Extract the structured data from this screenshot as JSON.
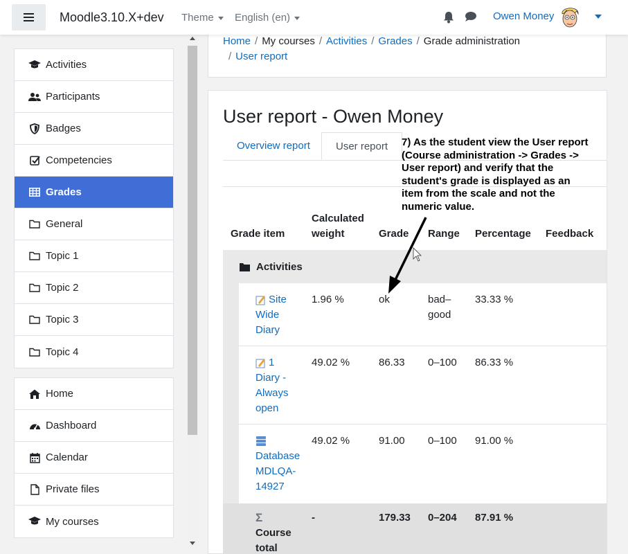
{
  "navbar": {
    "brand": "Moodle3.10.X+dev",
    "theme_label": "Theme",
    "language_label": "English (en)",
    "user_name": "Owen Money"
  },
  "drawer": {
    "course_items": [
      {
        "label": "Activities",
        "icon": "graduation-cap-icon"
      },
      {
        "label": "Participants",
        "icon": "users-icon"
      },
      {
        "label": "Badges",
        "icon": "shield-icon"
      },
      {
        "label": "Competencies",
        "icon": "check-square-icon"
      },
      {
        "label": "Grades",
        "icon": "table-icon",
        "active": true
      },
      {
        "label": "General",
        "icon": "folder-icon"
      },
      {
        "label": "Topic 1",
        "icon": "folder-icon"
      },
      {
        "label": "Topic 2",
        "icon": "folder-icon"
      },
      {
        "label": "Topic 3",
        "icon": "folder-icon"
      },
      {
        "label": "Topic 4",
        "icon": "folder-icon"
      }
    ],
    "site_items": [
      {
        "label": "Home",
        "icon": "home-icon"
      },
      {
        "label": "Dashboard",
        "icon": "dashboard-icon"
      },
      {
        "label": "Calendar",
        "icon": "calendar-icon"
      },
      {
        "label": "Private files",
        "icon": "file-icon"
      },
      {
        "label": "My courses",
        "icon": "graduation-cap-icon"
      }
    ]
  },
  "breadcrumb": [
    "Home",
    "My courses",
    "Activities",
    "Grades",
    "Grade administration",
    "User report"
  ],
  "page": {
    "title": "User report - Owen Money",
    "tabs": [
      {
        "label": "Overview report",
        "active": false
      },
      {
        "label": "User report",
        "active": true
      }
    ]
  },
  "table": {
    "headers": {
      "grade_item": "Grade item",
      "weight_line1": "Calculated",
      "weight_line2": "weight",
      "grade": "Grade",
      "range": "Range",
      "percentage": "Percentage",
      "feedback": "Feedback"
    },
    "category": "Activities",
    "rows": [
      {
        "name_lines": [
          "Site",
          "Wide",
          "Diary"
        ],
        "weight": "1.96 %",
        "grade": "ok",
        "range_lines": [
          "bad–",
          "good"
        ],
        "percentage": "33.33 %",
        "icon": "diary-icon"
      },
      {
        "name_lines": [
          "1",
          "Diary -",
          "Always",
          "open"
        ],
        "weight": "49.02 %",
        "grade": "86.33",
        "range_lines": [
          "0–100"
        ],
        "percentage": "86.33 %",
        "icon": "diary-icon"
      },
      {
        "name_lines": [
          "Database",
          "MDLQA-",
          "14927"
        ],
        "weight": "49.02 %",
        "grade": "91.00",
        "range_lines": [
          "0–100"
        ],
        "percentage": "91.00 %",
        "icon": "database-icon"
      }
    ],
    "total": {
      "symbol": "Σ",
      "label_lines": [
        "Course",
        "total"
      ],
      "weight": "-",
      "grade": "179.33",
      "range": "0–204",
      "percentage": "87.91 %"
    }
  },
  "annotation": {
    "lines": [
      " 7) As the student view the User report",
      "(Course administration -> Grades ->",
      "User report) and verify that the",
      "student's grade is displayed as an",
      "item from the scale and not the",
      "numeric value."
    ]
  },
  "colors": {
    "accent": "#0f6cbf",
    "active_nav": "#3f6fd6"
  }
}
